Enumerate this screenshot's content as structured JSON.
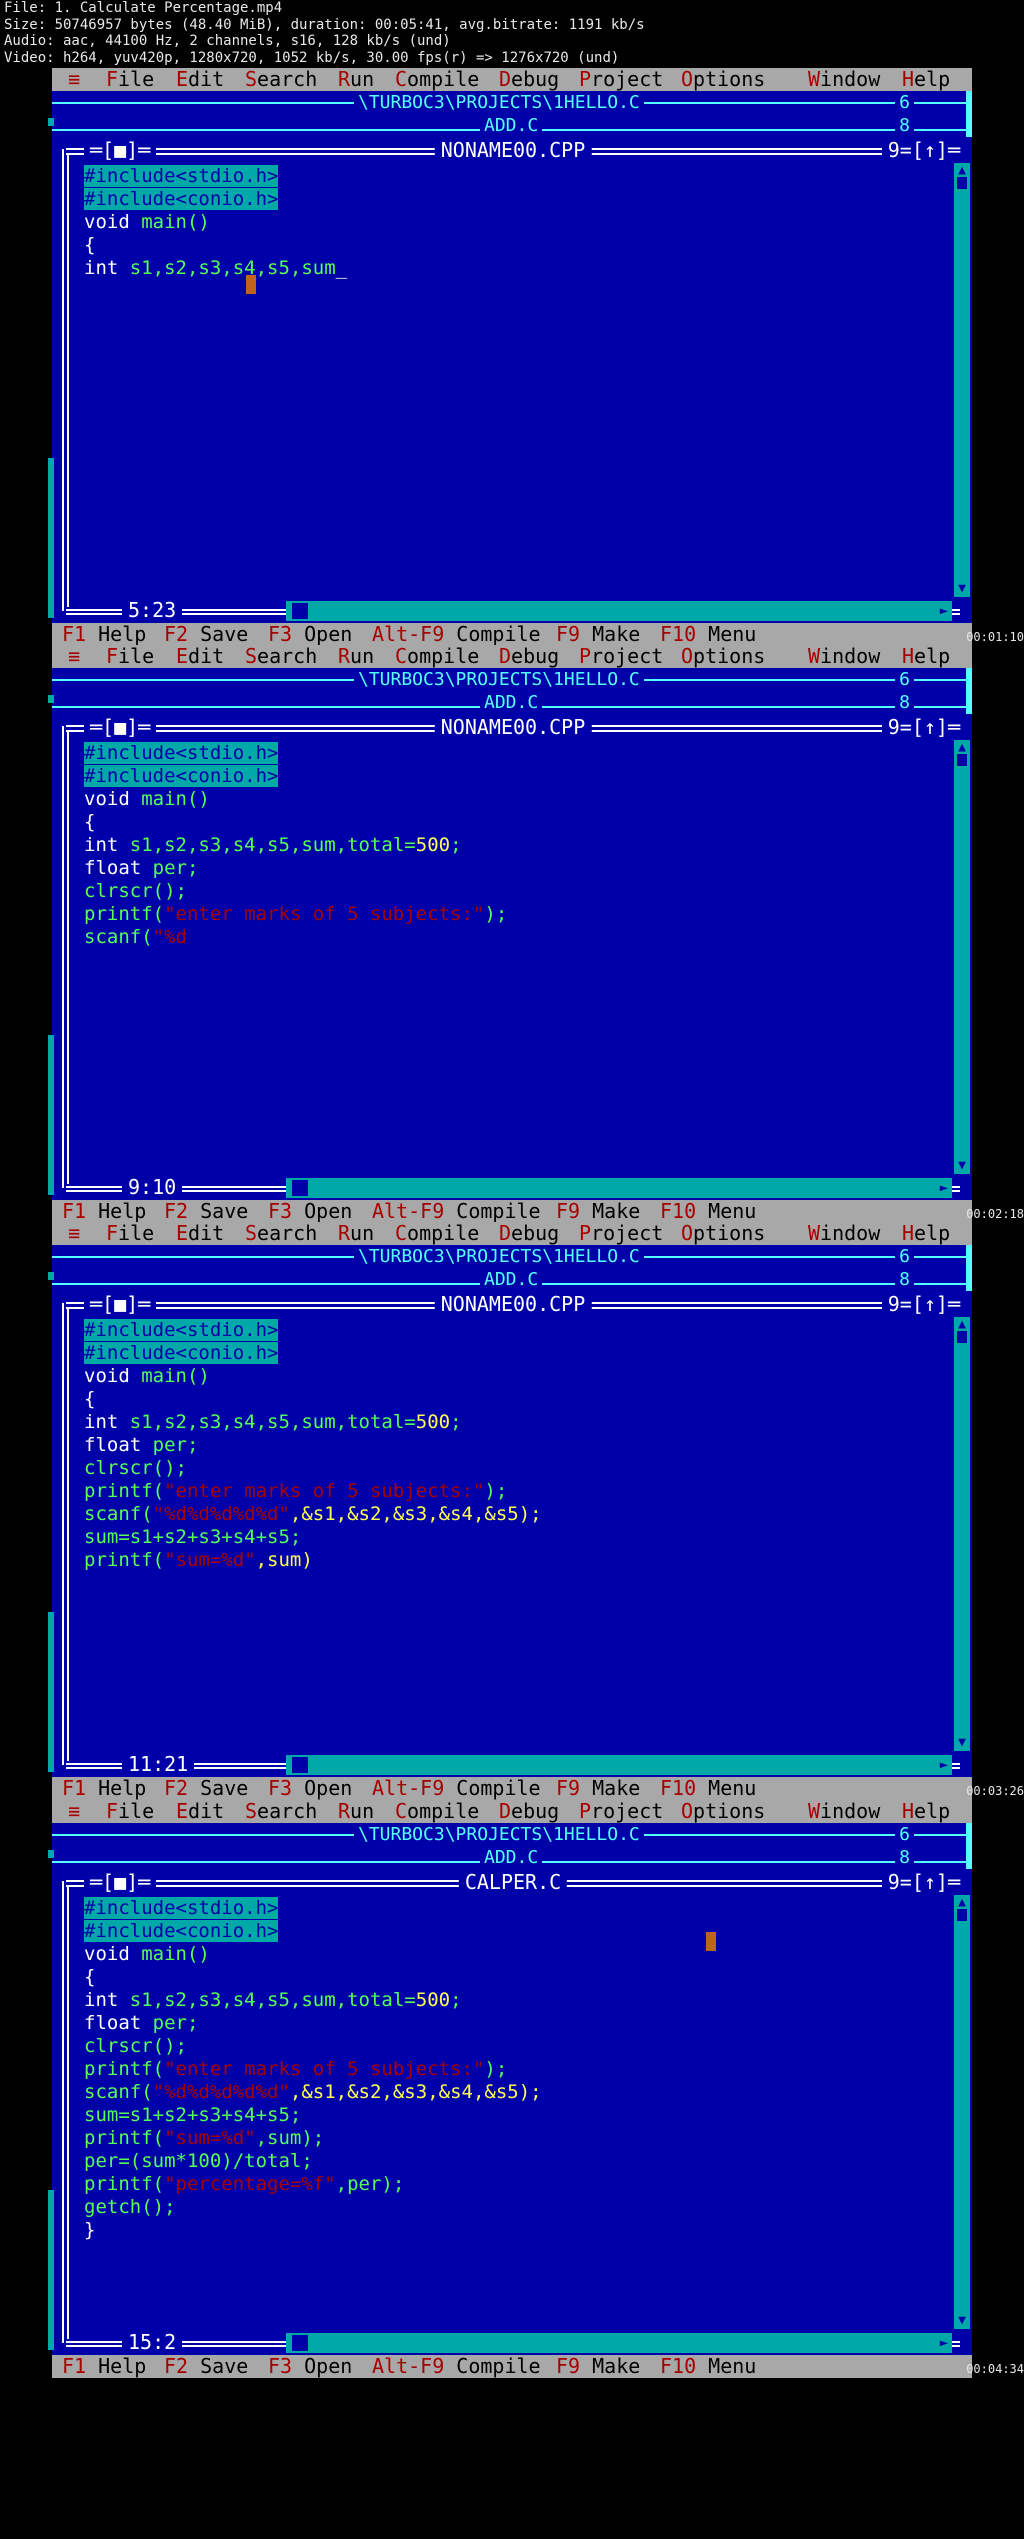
{
  "header": {
    "line1": "File: 1. Calculate Percentage.mp4",
    "line2": "Size: 50746957 bytes (48.40 MiB), duration: 00:05:41, avg.bitrate: 1191 kb/s",
    "line3": "Audio: aac, 44100 Hz, 2 channels, s16, 128 kb/s (und)",
    "line4": "Video: h264, yuv420p, 1280x720, 1052 kb/s, 30.00 fps(r) => 1276x720 (und)"
  },
  "menu": {
    "sys": "≡",
    "file": [
      "F",
      "ile"
    ],
    "edit": [
      "E",
      "dit"
    ],
    "search": [
      "S",
      "earch"
    ],
    "run": [
      "R",
      "un"
    ],
    "compile": [
      "C",
      "ompile"
    ],
    "debug": [
      "D",
      "ebug"
    ],
    "project": [
      "P",
      "roject"
    ],
    "options": [
      "O",
      "ptions"
    ],
    "window": [
      "W",
      "indow"
    ],
    "help": [
      "H",
      "elp"
    ]
  },
  "bg_windows": {
    "hello_title": "\\TURBOC3\\PROJECTS\\1HELLO.C",
    "hello_num": "6",
    "add_title": "ADD.C",
    "add_num": "8"
  },
  "window_controls": {
    "close": "═[■]═",
    "num": "9",
    "zoom": "=[↑]═"
  },
  "status": {
    "f1": "F1",
    "help": "Help",
    "f2": "F2",
    "save": "Save",
    "f3": "F3",
    "open": "Open",
    "altf9": "Alt-F9",
    "compile": "Compile",
    "f9": "F9",
    "make": "Make",
    "f10": "F10",
    "menu": "Menu"
  },
  "frames": [
    {
      "filename": "NONAME00.CPP",
      "position": "5:23",
      "timestamp": "00:01:10",
      "code": [
        [
          [
            "pp",
            "#include<stdio.h>"
          ]
        ],
        [
          [
            "pp",
            "#include<conio.h>"
          ]
        ],
        [
          [
            "t",
            "void "
          ],
          [
            "k",
            "main()"
          ]
        ],
        [
          [
            "t",
            "{"
          ]
        ],
        [
          [
            "t",
            "int "
          ],
          [
            "k",
            "s1,s2,s3,s4,s5,sum"
          ],
          [
            "t",
            "_"
          ]
        ]
      ]
    },
    {
      "filename": "NONAME00.CPP",
      "position": "9:10",
      "timestamp": "00:02:18",
      "code": [
        [
          [
            "pp",
            "#include<stdio.h>"
          ]
        ],
        [
          [
            "pp",
            "#include<conio.h>"
          ]
        ],
        [
          [
            "t",
            "void "
          ],
          [
            "k",
            "main()"
          ]
        ],
        [
          [
            "t",
            "{"
          ]
        ],
        [
          [
            "t",
            "int "
          ],
          [
            "k",
            "s1,s2,s3,s4,s5,sum,total="
          ],
          [
            "n",
            "500"
          ],
          [
            "k",
            ";"
          ]
        ],
        [
          [
            "t",
            "float "
          ],
          [
            "k",
            "per;"
          ]
        ],
        [
          [
            "k",
            "clrscr();"
          ]
        ],
        [
          [
            "k",
            "printf("
          ],
          [
            "s",
            "\"enter marks of 5 subjects:\""
          ],
          [
            "k",
            ");"
          ]
        ],
        [
          [
            "k",
            "scanf("
          ],
          [
            "s",
            "\"%d"
          ]
        ]
      ]
    },
    {
      "filename": "NONAME00.CPP",
      "position": "11:21",
      "timestamp": "00:03:26",
      "code": [
        [
          [
            "pp",
            "#include<stdio.h>"
          ]
        ],
        [
          [
            "pp",
            "#include<conio.h>"
          ]
        ],
        [
          [
            "t",
            "void "
          ],
          [
            "k",
            "main()"
          ]
        ],
        [
          [
            "t",
            "{"
          ]
        ],
        [
          [
            "t",
            "int "
          ],
          [
            "k",
            "s1,s2,s3,s4,s5,sum,total="
          ],
          [
            "n",
            "500"
          ],
          [
            "k",
            ";"
          ]
        ],
        [
          [
            "t",
            "float "
          ],
          [
            "k",
            "per;"
          ]
        ],
        [
          [
            "k",
            "clrscr();"
          ]
        ],
        [
          [
            "k",
            "printf("
          ],
          [
            "s",
            "\"enter marks of 5 subjects:\""
          ],
          [
            "k",
            ");"
          ]
        ],
        [
          [
            "k",
            "scanf("
          ],
          [
            "s",
            "\"%d%d%d%d%d\""
          ],
          [
            "n",
            ",&s1,&s2,&s3,&s4,&s5);"
          ]
        ],
        [
          [
            "k",
            "sum=s1+s2+s3+s4+s5;"
          ]
        ],
        [
          [
            "k",
            "printf("
          ],
          [
            "s",
            "\"sum=%d\""
          ],
          [
            "n",
            ",sum)"
          ]
        ]
      ]
    },
    {
      "filename": "CALPER.C",
      "position": "15:2",
      "timestamp": "00:04:34",
      "code": [
        [
          [
            "pp",
            "#include<stdio.h>"
          ]
        ],
        [
          [
            "pp",
            "#include<conio.h>"
          ]
        ],
        [
          [
            "t",
            "void "
          ],
          [
            "k",
            "main()"
          ]
        ],
        [
          [
            "t",
            "{"
          ]
        ],
        [
          [
            "t",
            "int "
          ],
          [
            "k",
            "s1,s2,s3,s4,s5,sum,total="
          ],
          [
            "n",
            "500"
          ],
          [
            "k",
            ";"
          ]
        ],
        [
          [
            "t",
            "float "
          ],
          [
            "k",
            "per;"
          ]
        ],
        [
          [
            "k",
            "clrscr();"
          ]
        ],
        [
          [
            "k",
            "printf("
          ],
          [
            "s",
            "\"enter marks of 5 subjects:\""
          ],
          [
            "k",
            ");"
          ]
        ],
        [
          [
            "k",
            "scanf("
          ],
          [
            "s",
            "\"%d%d%d%d%d\""
          ],
          [
            "n",
            ",&s1,&s2,&s3,&s4,&s5);"
          ]
        ],
        [
          [
            "k",
            "sum=s1+s2+s3+s4+s5;"
          ]
        ],
        [
          [
            "k",
            "printf("
          ],
          [
            "s",
            "\"sum=%d\""
          ],
          [
            "k",
            ",sum);"
          ]
        ],
        [
          [
            "k",
            "per=(sum*100)/total;"
          ]
        ],
        [
          [
            "k",
            "printf("
          ],
          [
            "s",
            "\"percentage=%f\""
          ],
          [
            "k",
            ",per);"
          ]
        ],
        [
          [
            "k",
            "getch();"
          ]
        ],
        [
          [
            "t",
            "}"
          ]
        ]
      ]
    }
  ]
}
